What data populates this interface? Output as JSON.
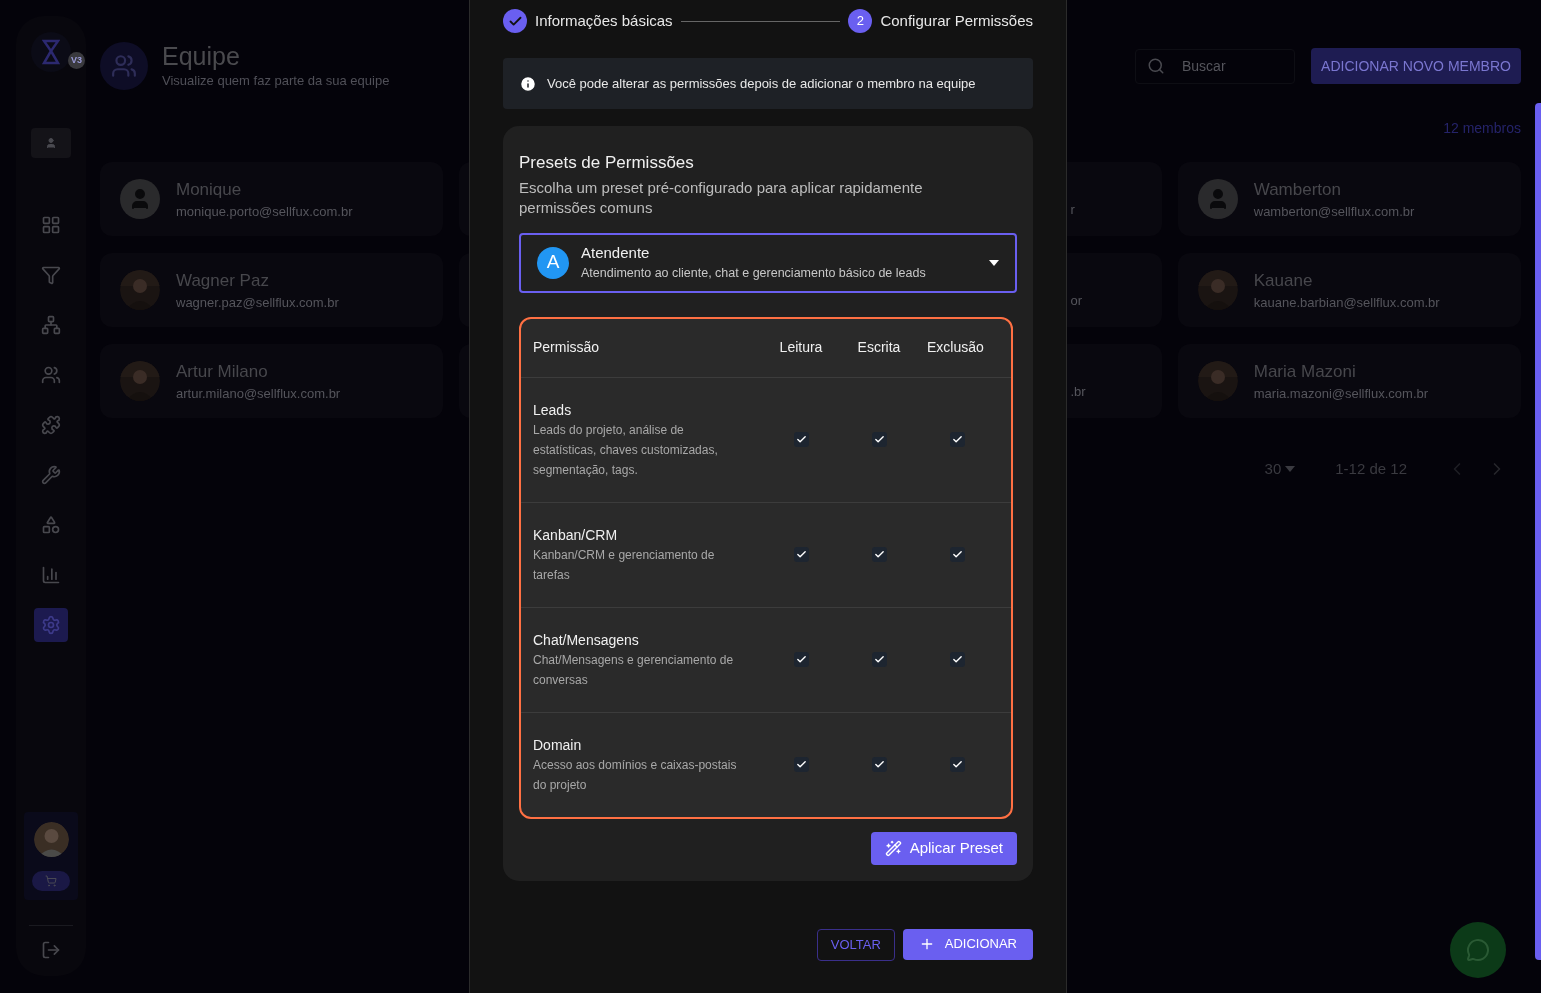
{
  "sidebar": {
    "logo_badge": "V3",
    "items": [
      {
        "selected": false
      },
      {
        "selected": false
      },
      {
        "selected": false
      },
      {
        "selected": false
      },
      {
        "selected": false
      },
      {
        "selected": false
      },
      {
        "selected": false
      },
      {
        "selected": false
      },
      {
        "selected": true
      }
    ]
  },
  "header": {
    "title": "Equipe",
    "subtitle": "Visualize quem faz parte da sua equipe",
    "search": {
      "placeholder": "Buscar"
    },
    "add_button": "ADICIONAR NOVO MEMBRO",
    "member_count": "12 membros"
  },
  "members": [
    {
      "name": "Monique",
      "email": "monique.porto@sellfux.com.br",
      "kind": "placeholder"
    },
    {
      "email_fragment": "r"
    },
    {
      "name": "Wamberton",
      "email": "wamberton@sellflux.com.br",
      "kind": "placeholder"
    },
    {
      "name": "Wagner Paz",
      "email": "wagner.paz@sellflux.com.br"
    },
    {
      "email_fragment": "or"
    },
    {
      "name": "Kauane",
      "email": "kauane.barbian@sellflux.com.br"
    },
    {
      "name": "Artur Milano",
      "email": "artur.milano@sellflux.com.br"
    },
    {
      "email_fragment": ".br"
    },
    {
      "name": "Maria Mazoni",
      "email": "maria.mazoni@sellflux.com.br"
    }
  ],
  "pagination": {
    "per_page": "30",
    "range": "1-12 de 12"
  },
  "modal": {
    "steps": [
      {
        "label": "Informações básicas",
        "completed": true
      },
      {
        "label": "Configurar Permissões",
        "completed": false,
        "number": "2"
      }
    ],
    "info": "Você pode alterar as permissões depois de adicionar o membro na equipe",
    "presets": {
      "title": "Presets de Permissões",
      "description": "Escolha um preset pré-configurado para aplicar rapidamente permissões comuns",
      "select": {
        "initial": "A",
        "name": "Atendente",
        "description": "Atendimento ao cliente, chat e gerenciamento básico de leads"
      },
      "columns": [
        "Permissão",
        "Leitura",
        "Escrita",
        "Exclusão"
      ],
      "rows": [
        {
          "name": "Leads",
          "description": "Leads do projeto, análise de estatísticas, chaves customizadas, segmentação, tags.",
          "read": true,
          "write": true,
          "delete": true
        },
        {
          "name": "Kanban/CRM",
          "description": "Kanban/CRM e gerenciamento de tarefas",
          "read": true,
          "write": true,
          "delete": true
        },
        {
          "name": "Chat/Mensagens",
          "description": "Chat/Mensagens e gerenciamento de conversas",
          "read": true,
          "write": true,
          "delete": true
        },
        {
          "name": "Domain",
          "description": "Acesso aos domínios e caixas-postais do projeto",
          "read": true,
          "write": true,
          "delete": true
        }
      ],
      "apply_button": "Aplicar Preset"
    },
    "back_button": "VOLTAR",
    "submit_button": "ADICIONAR"
  }
}
